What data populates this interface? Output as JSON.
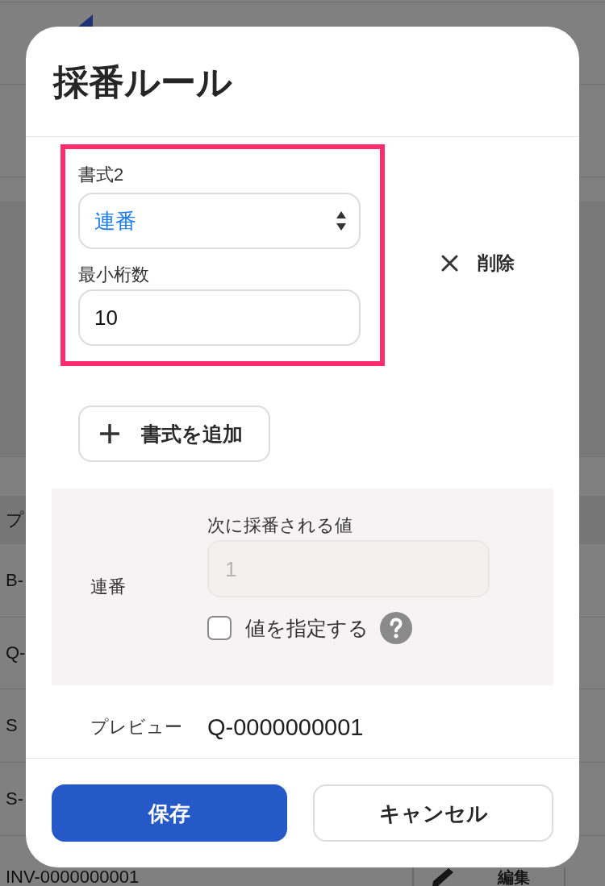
{
  "background_page": {
    "table": {
      "columns": [
        "プ"
      ],
      "rows": [
        {
          "column_1": "B-"
        },
        {
          "column_1": "Q-"
        },
        {
          "column_1": "S"
        },
        {
          "column_1": "S-"
        },
        {
          "column_1": "INV-0000000001",
          "edit_button": "編集"
        }
      ]
    }
  },
  "dialog": {
    "title": "採番ルール",
    "format_item": {
      "highlighted": true,
      "label": "書式2",
      "select_value": "連番",
      "min_digits": {
        "label": "最小桁数",
        "value": "10"
      },
      "delete_button": "削除"
    },
    "add_format_button": "書式を追加",
    "sequence_panel": {
      "label": "連番",
      "next_value": {
        "label": "次に採番される値",
        "value": "1",
        "disabled": true
      },
      "specify_value": {
        "label": "値を指定する",
        "checked": false
      }
    },
    "preview": {
      "label": "プレビュー",
      "value": "Q-0000000001"
    },
    "buttons": [
      {
        "label": "保存",
        "kind": "primary"
      },
      {
        "label": "キャンセル",
        "kind": "secondary"
      }
    ]
  }
}
